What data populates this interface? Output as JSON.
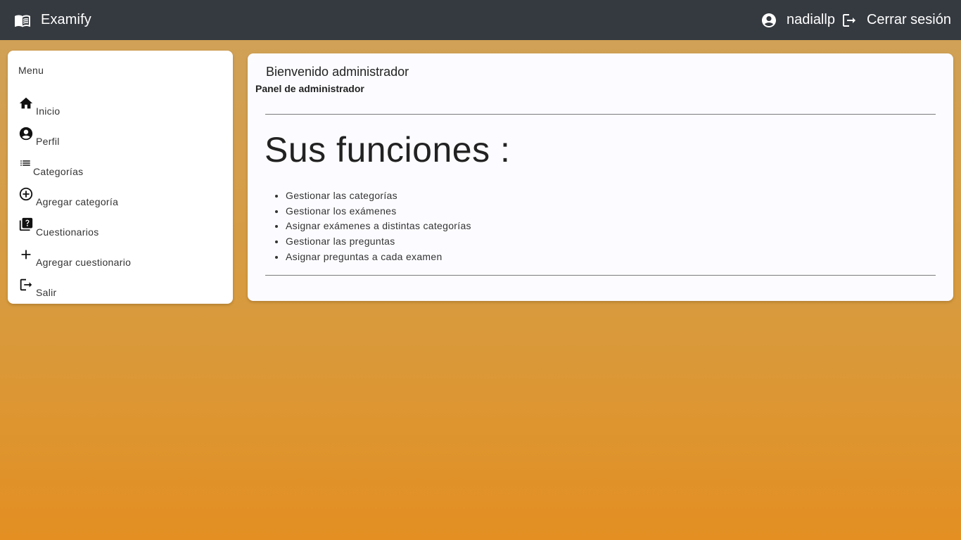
{
  "header": {
    "app_title": "Examify",
    "logo_icon": "open-book-icon",
    "user_icon": "account-circle-icon",
    "username": "nadiallp",
    "logout_icon": "logout-icon",
    "logout_label": "Cerrar sesión"
  },
  "sidebar": {
    "title": "Menu",
    "items": [
      {
        "icon": "home-icon",
        "label": "Inicio"
      },
      {
        "icon": "account-circle-icon",
        "label": "Perfil"
      },
      {
        "icon": "list-icon",
        "label": "Categorías"
      },
      {
        "icon": "add-circle-outline-icon",
        "label": "Agregar categoría"
      },
      {
        "icon": "quiz-icon",
        "label": "Cuestionarios"
      },
      {
        "icon": "plus-icon",
        "label": "Agregar cuestionario"
      },
      {
        "icon": "logout-icon",
        "label": "Salir"
      }
    ]
  },
  "main": {
    "welcome": "Bienvenido administrador",
    "subtitle": "Panel de administrador",
    "heading": "Sus funciones :",
    "functions": [
      "Gestionar las categorías",
      "Gestionar los exámenes",
      "Asignar exámenes a distintas categorías",
      "Gestionar las preguntas",
      "Asignar preguntas a cada examen"
    ]
  },
  "colors": {
    "topbar": "#353a40",
    "background_top": "#cfa25a",
    "background_bottom": "#e38f22",
    "card": "#fcfbff"
  }
}
